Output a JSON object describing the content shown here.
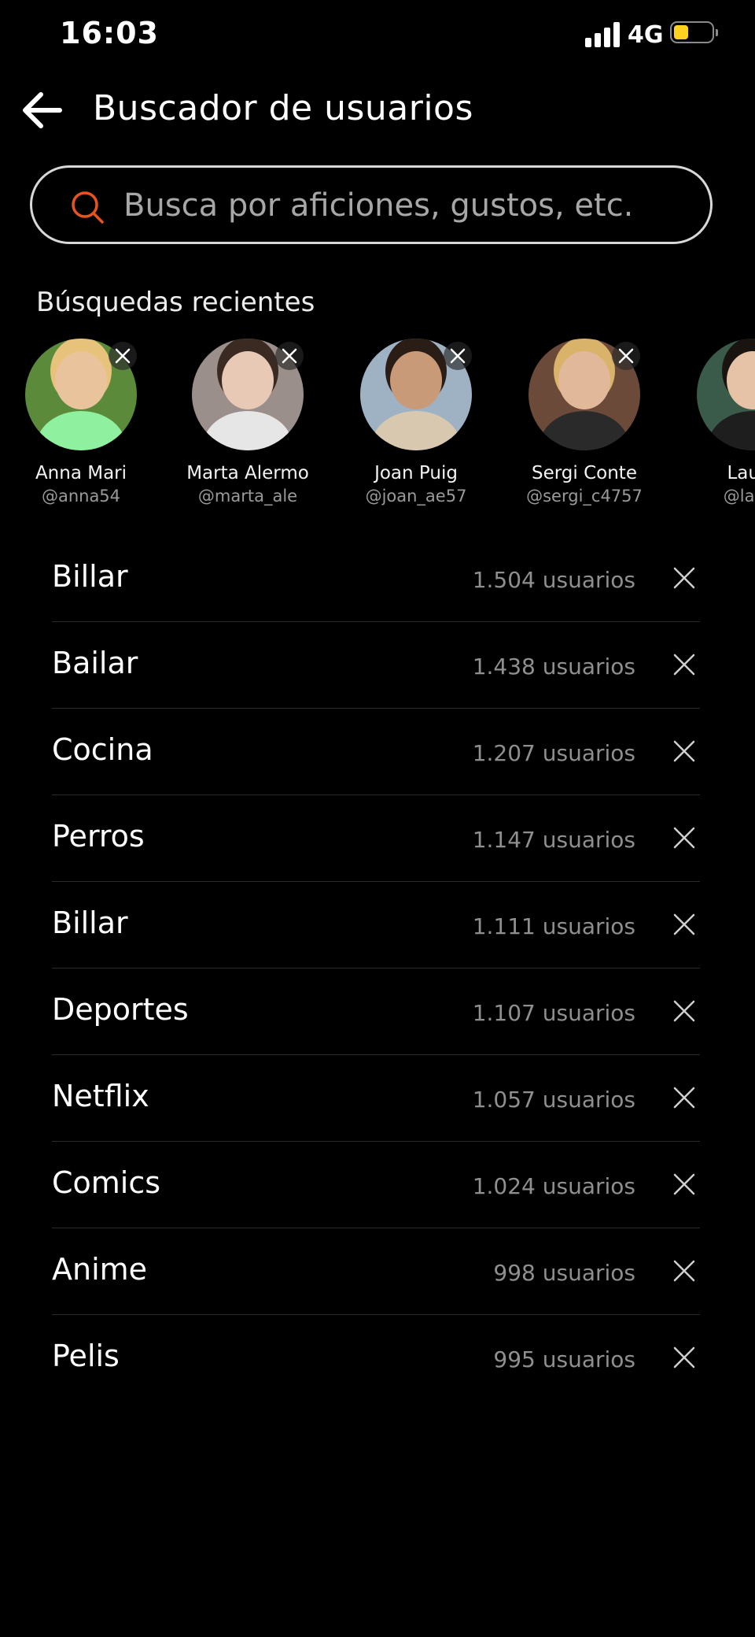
{
  "status_bar": {
    "time": "16:03",
    "network": "4G",
    "signal_bars": 4,
    "battery_level": 0.4,
    "battery_color": "#ffd21f"
  },
  "header": {
    "back_icon": "arrow-left-icon",
    "title": "Buscador de usuarios"
  },
  "search": {
    "icon": "search-icon",
    "icon_color": "#e8541e",
    "placeholder": "Busca por aficiones, gustos, etc."
  },
  "recent": {
    "heading": "Búsquedas recientes",
    "users": [
      {
        "name": "Anna Mari",
        "handle": "@anna54"
      },
      {
        "name": "Marta Alermo",
        "handle": "@marta_ale"
      },
      {
        "name": "Joan Puig",
        "handle": "@joan_ae57"
      },
      {
        "name": "Sergi Conte",
        "handle": "@sergi_c4757"
      },
      {
        "name": "Laura",
        "handle": "@laura"
      }
    ]
  },
  "interests": [
    {
      "name": "Billar",
      "count": "1.504 usuarios"
    },
    {
      "name": "Bailar",
      "count": "1.438 usuarios"
    },
    {
      "name": "Cocina",
      "count": "1.207 usuarios"
    },
    {
      "name": "Perros",
      "count": "1.147 usuarios"
    },
    {
      "name": "Billar",
      "count": "1.111 usuarios"
    },
    {
      "name": "Deportes",
      "count": "1.107 usuarios"
    },
    {
      "name": "Netflix",
      "count": "1.057 usuarios"
    },
    {
      "name": "Comics",
      "count": "1.024 usuarios"
    },
    {
      "name": "Anime",
      "count": "998  usuarios"
    },
    {
      "name": "Pelis",
      "count": "995 usuarios"
    }
  ]
}
